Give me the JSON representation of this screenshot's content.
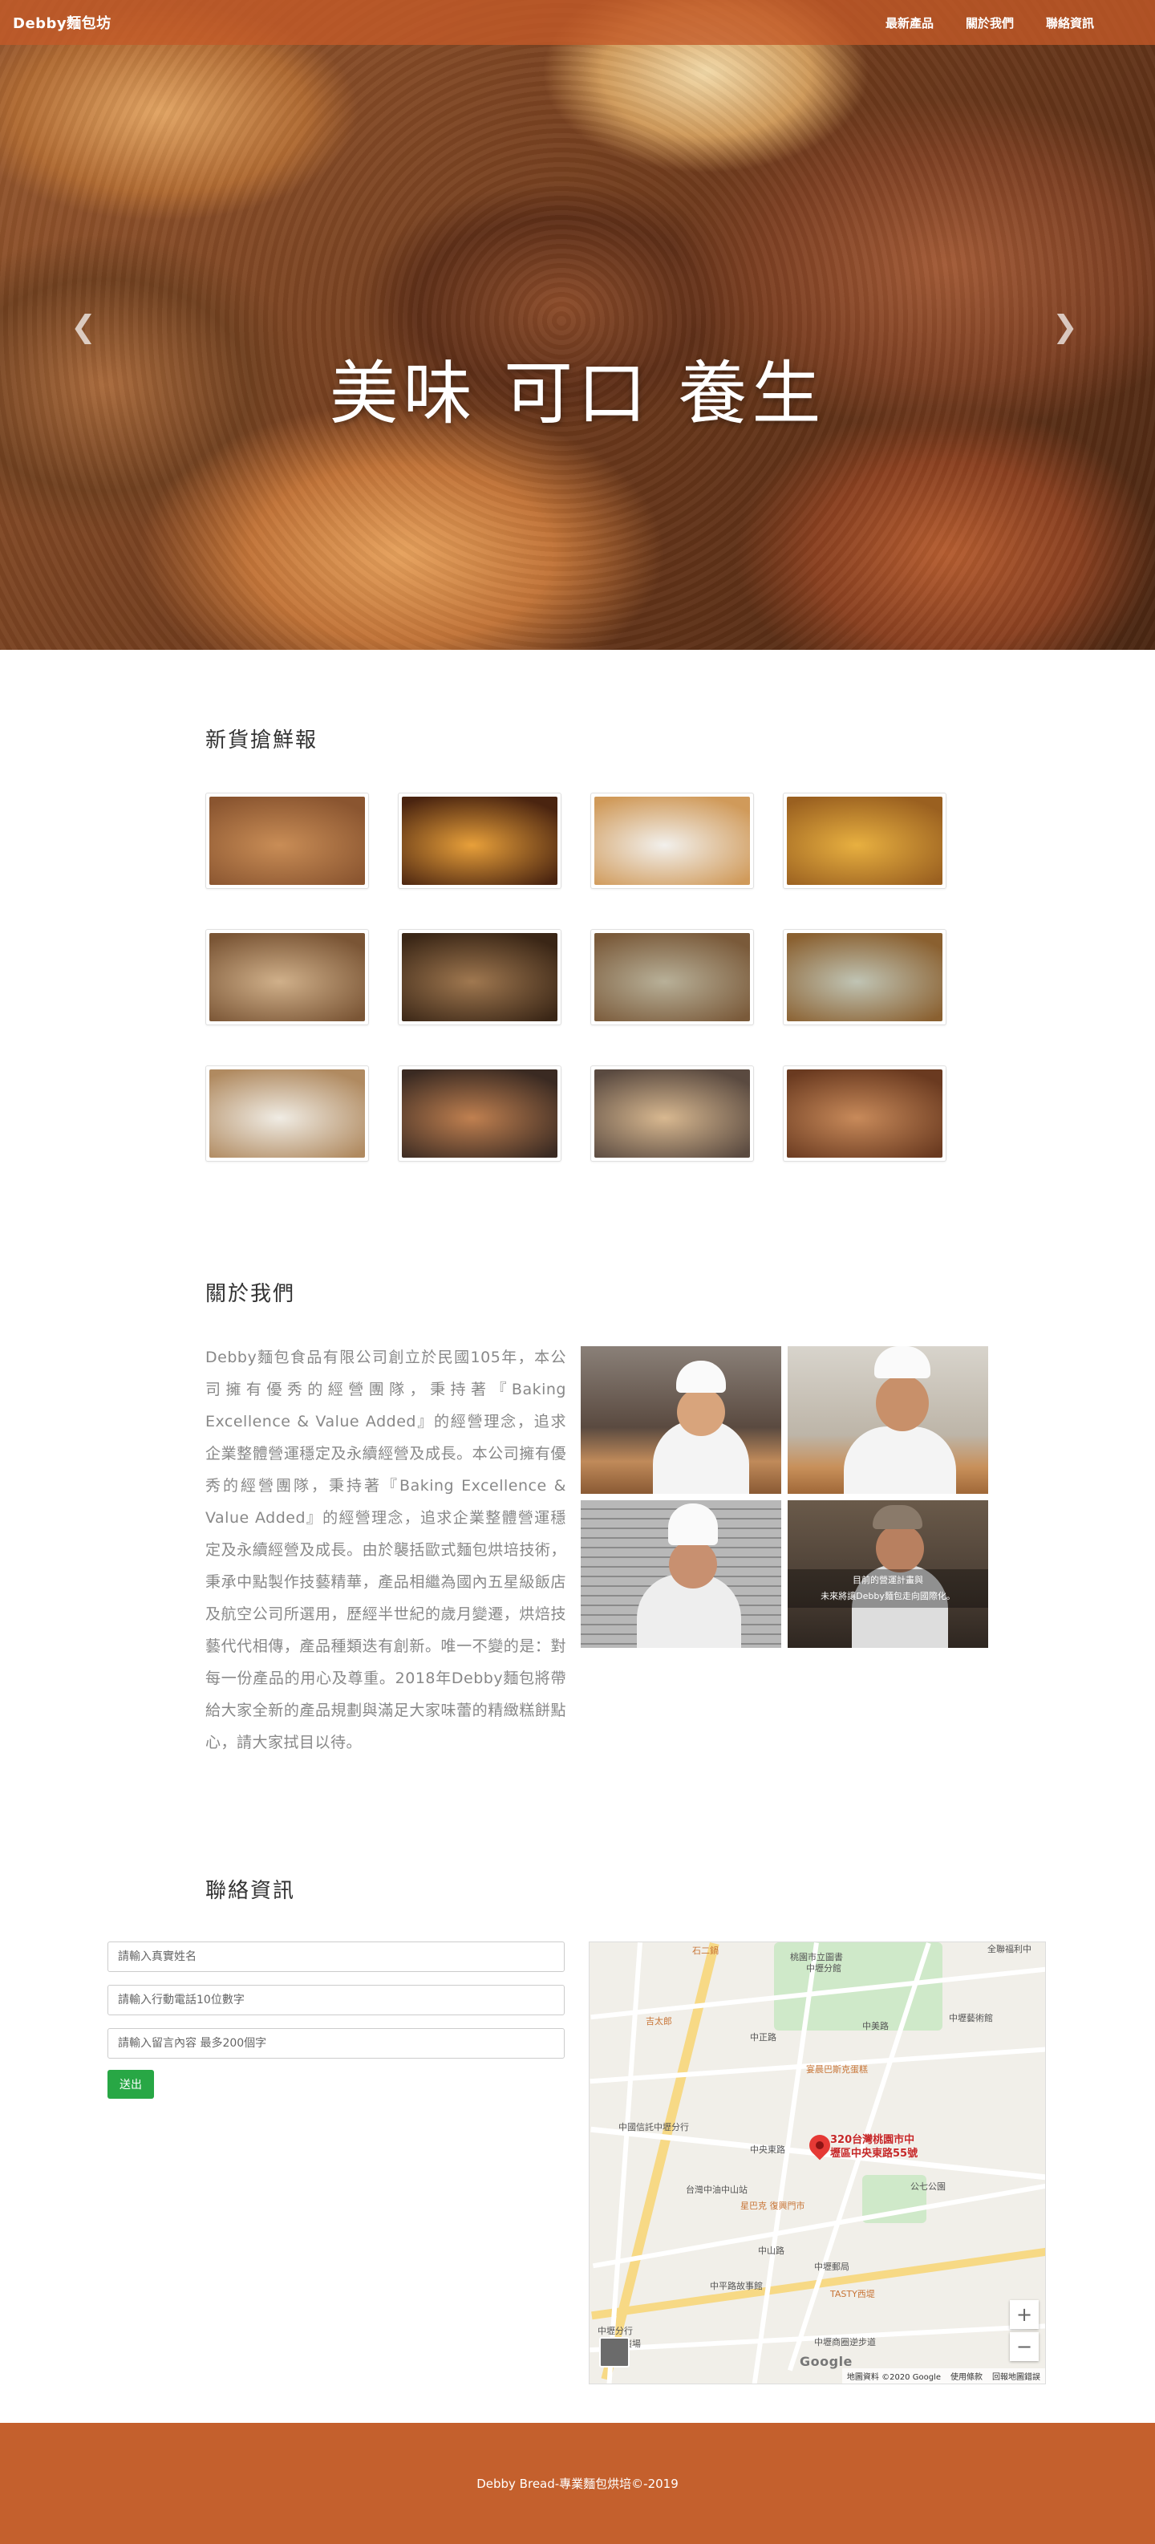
{
  "navbar": {
    "brand": "Debby麵包坊",
    "links": [
      "最新產品",
      "關於我們",
      "聯絡資訊"
    ]
  },
  "hero": {
    "title": "美味 可口 養生",
    "prev_icon": "chevron-left-icon",
    "next_icon": "chevron-right-icon"
  },
  "products": {
    "title": "新貨搶鮮報",
    "items": [
      {
        "name": "artisan-bread-loaves",
        "colors": [
          "#c98d56",
          "#8a5530"
        ]
      },
      {
        "name": "oven-baking",
        "colors": [
          "#e8a03a",
          "#4a2410"
        ]
      },
      {
        "name": "sugar-croissant",
        "colors": [
          "#f2f0ec",
          "#d09a5a"
        ]
      },
      {
        "name": "custard-pastries",
        "colors": [
          "#e8b040",
          "#9a6020"
        ]
      },
      {
        "name": "bread-basket",
        "colors": [
          "#d0b08a",
          "#7a5535"
        ]
      },
      {
        "name": "bread-shelves",
        "colors": [
          "#a07850",
          "#3a2616"
        ]
      },
      {
        "name": "rustic-loaf-basket",
        "colors": [
          "#b8b098",
          "#7a5a3a"
        ]
      },
      {
        "name": "sliced-cake",
        "colors": [
          "#c0c4b4",
          "#8a6030"
        ]
      },
      {
        "name": "sourdough-board",
        "colors": [
          "#f0ece4",
          "#b08a60"
        ]
      },
      {
        "name": "poppy-bagel",
        "colors": [
          "#c08050",
          "#3a2a22"
        ]
      },
      {
        "name": "baguette-pieces",
        "colors": [
          "#d8b890",
          "#5a4a40"
        ]
      },
      {
        "name": "country-breads",
        "colors": [
          "#c88a5a",
          "#6a3a20"
        ]
      }
    ]
  },
  "about": {
    "title": "關於我們",
    "text": "Debby麵包食品有限公司創立於民國105年，本公司擁有優秀的經營團隊，秉持著『Baking Excellence & Value Added』的經營理念，追求企業整體營運穩定及永續經營及成長。本公司擁有優秀的經營團隊，秉持著『Baking Excellence & Value Added』的經營理念，追求企業整體營運穩定及永續經營及成長。由於襲括歐式麵包烘培技術，秉承中點製作技藝精華，產品相繼為國內五星級飯店及航空公司所選用，歷經半世紀的歲月變遷，烘焙技藝代代相傳，產品種類迭有創新。唯一不變的是：對每一份產品的用心及尊重。2018年Debby麵包將帶給大家全新的產品規劃與滿足大家味蕾的精緻糕餅點心，請大家拭目以待。",
    "caption_line1": "目前的營運計畫與",
    "caption_line2": "未來將讓Debby麵包走向國際化。"
  },
  "contact": {
    "title": "聯絡資訊",
    "name_placeholder": "請輸入真實姓名",
    "phone_placeholder": "請輸入行動電話10位數字",
    "message_placeholder": "請輸入留言內容 最多200個字",
    "submit_label": "送出"
  },
  "map": {
    "address_line1": "320台灣桃園市中",
    "address_line2": "壢區中央東路55號",
    "labels": [
      "石二鍋",
      "桃園市立圖書",
      "中壢分館",
      "全聯福利中",
      "吉太郎",
      "中正路",
      "中美路",
      "中壢藝術館",
      "宴晨巴斯克蛋糕",
      "中國信託中壢分行",
      "中央東路",
      "公七公園",
      "台灣中油中山站",
      "中山路",
      "星巴克 復興門市",
      "中壢郵局",
      "中平路故事館",
      "TASTY西堤",
      "中壢商圈逆步道",
      "中壢分行",
      "文化廣場",
      "Google"
    ],
    "footer_data": "地圖資料 ©2020 Google",
    "footer_terms": "使用條款",
    "footer_report": "回報地圖錯誤",
    "zoom_in": "+",
    "zoom_out": "−"
  },
  "footer": {
    "text": "Debby Bread-專業麵包烘培©-2019"
  }
}
